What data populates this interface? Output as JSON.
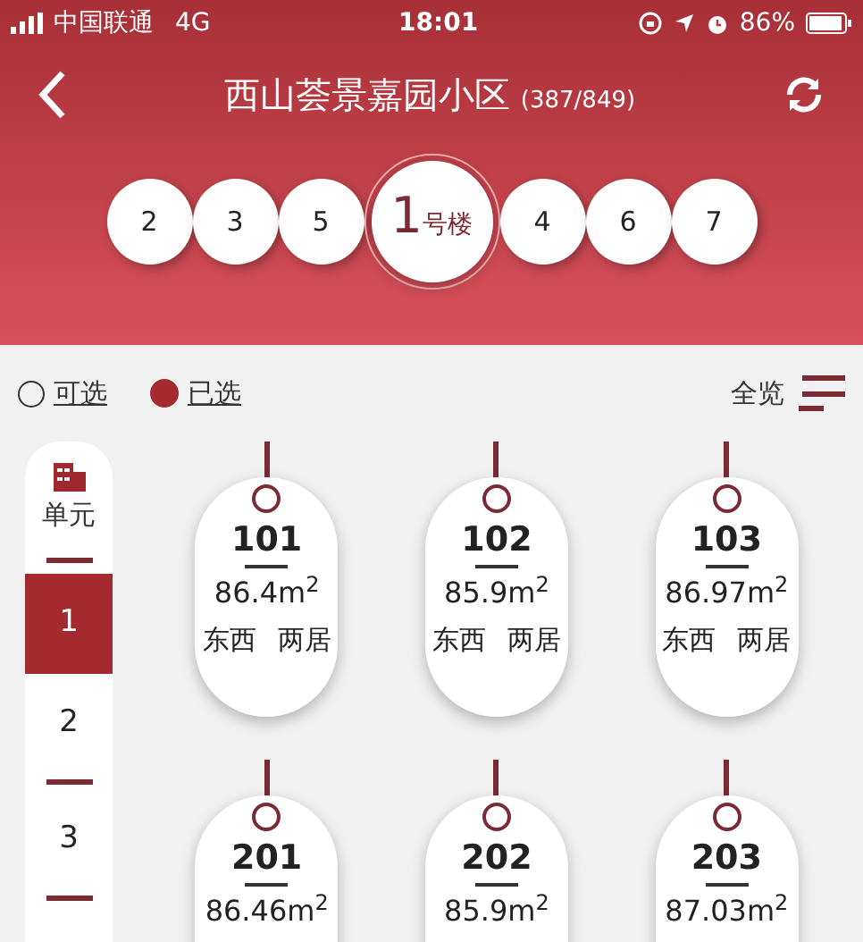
{
  "status_bar": {
    "carrier": "中国联通",
    "network": "4G",
    "time": "18:01",
    "battery": "86%"
  },
  "header": {
    "title": "西山荟景嘉园小区",
    "count": "(387/849)"
  },
  "buildings": [
    {
      "number": "2",
      "selected": false
    },
    {
      "number": "3",
      "selected": false
    },
    {
      "number": "5",
      "selected": false
    },
    {
      "number": "1",
      "suffix": "号楼",
      "selected": true
    },
    {
      "number": "4",
      "selected": false
    },
    {
      "number": "6",
      "selected": false
    },
    {
      "number": "7",
      "selected": false
    }
  ],
  "legend": [
    {
      "kind": "available",
      "label": "可选"
    },
    {
      "kind": "chosen",
      "label": "已选"
    }
  ],
  "overview": "全览",
  "units": {
    "title": "单元",
    "items": [
      {
        "label": "1",
        "selected": true
      },
      {
        "label": "2",
        "selected": false
      },
      {
        "label": "3",
        "selected": false
      }
    ]
  },
  "rooms": [
    {
      "number": "101",
      "area": "86.4m$^{2}$",
      "orientation": "东西",
      "layout": "两居"
    },
    {
      "number": "102",
      "area": "85.9m$^{2}$",
      "orientation": "东西",
      "layout": "两居"
    },
    {
      "number": "103",
      "area": "86.97m$^{2}$",
      "orientation": "东西",
      "layout": "两居"
    },
    {
      "number": "201",
      "area": "86.46m$^{2}$"
    },
    {
      "number": "202",
      "area": "85.9m$^{2}$"
    },
    {
      "number": "203",
      "area": "87.03m$^{2}$"
    }
  ]
}
